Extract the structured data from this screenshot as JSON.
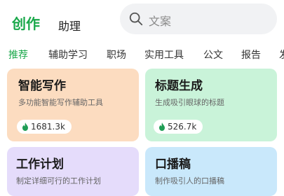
{
  "header": {
    "tab_active": "创作",
    "tab_inactive": "助理",
    "search_placeholder": "文案"
  },
  "categories": [
    "推荐",
    "辅助学习",
    "职场",
    "实用工具",
    "公文",
    "报告",
    "发"
  ],
  "cards": [
    {
      "title": "智能写作",
      "desc": "多功能智能写作辅助工具",
      "count": "1681.3k"
    },
    {
      "title": "标题生成",
      "desc": "生成吸引眼球的标题",
      "count": "526.7k"
    },
    {
      "title": "工作计划",
      "desc": "制定详细可行的工作计划"
    },
    {
      "title": "口播稿",
      "desc": "制作吸引人的口播稿"
    }
  ],
  "colors": {
    "accent": "#19a84a",
    "card1_bg": "#fcdcc0",
    "card2_bg": "#c9f3d9",
    "card3_bg": "#e5dcfb",
    "card4_bg": "#c9e8fb",
    "flame": "#1f9d55"
  },
  "icons": {
    "search": "search-icon",
    "flame": "flame-icon"
  }
}
